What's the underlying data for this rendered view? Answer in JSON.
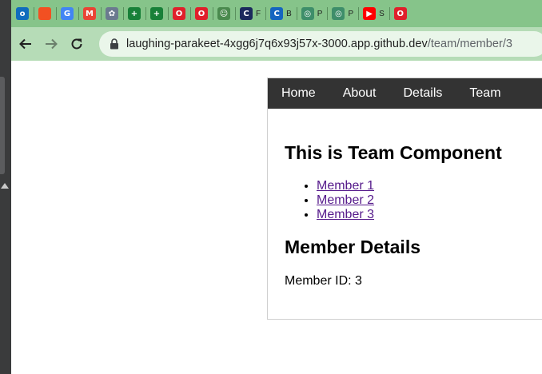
{
  "browser": {
    "bookmarks": [
      {
        "icon": "outlook-icon",
        "label": "",
        "color": "#0f6cbd",
        "glyph": "o"
      },
      {
        "icon": "microsoft-icon",
        "label": "",
        "color": "#f25022",
        "glyph": ""
      },
      {
        "icon": "translate-icon",
        "label": "",
        "color": "#4285f4",
        "glyph": "G"
      },
      {
        "icon": "gmail-icon",
        "label": "",
        "color": "#ea4335",
        "glyph": "M"
      },
      {
        "icon": "chatgpt-icon",
        "label": "",
        "color": "#6b7a8f",
        "glyph": "✿"
      },
      {
        "icon": "sheets-icon",
        "label": "",
        "color": "#188038",
        "glyph": "+"
      },
      {
        "icon": "sheets-icon-2",
        "label": "",
        "color": "#188038",
        "glyph": "+"
      },
      {
        "icon": "opera-icon",
        "label": "",
        "color": "#e0202b",
        "glyph": "O"
      },
      {
        "icon": "opera-icon-2",
        "label": "",
        "color": "#e0202b",
        "glyph": "O"
      },
      {
        "icon": "robot-icon",
        "label": "",
        "color": "#4a8a4e",
        "glyph": "☺"
      },
      {
        "icon": "cityu-icon",
        "label": "F",
        "color": "#1b2a5c",
        "glyph": "C"
      },
      {
        "icon": "c-logo-icon",
        "label": "B",
        "color": "#1565c0",
        "glyph": "C"
      },
      {
        "icon": "swirl-icon",
        "label": "P",
        "color": "#3e8e6a",
        "glyph": "◎"
      },
      {
        "icon": "swirl-icon-2",
        "label": "P",
        "color": "#3e8e6a",
        "glyph": "◎"
      },
      {
        "icon": "youtube-icon",
        "label": "S",
        "color": "#ff0000",
        "glyph": "▶"
      },
      {
        "icon": "opera-icon-3",
        "label": "",
        "color": "#e0202b",
        "glyph": "O"
      }
    ],
    "url_host": "laughing-parakeet-4xgg6j7q6x93j57x-3000.app.github.dev",
    "url_path": "/team/member/3"
  },
  "app": {
    "nav": [
      "Home",
      "About",
      "Details",
      "Team"
    ],
    "team_title": "This is Team Component",
    "members": [
      "Member 1",
      "Member 2",
      "Member 3"
    ],
    "details_title": "Member Details",
    "member_id": "Member ID: 3"
  }
}
